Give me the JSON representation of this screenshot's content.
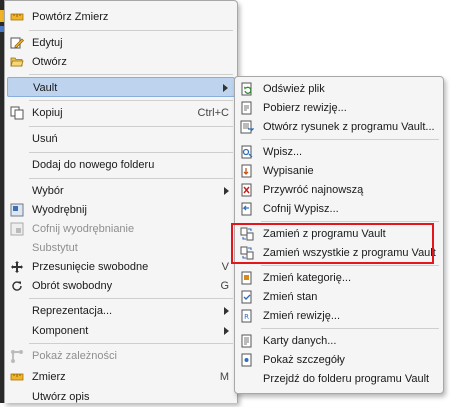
{
  "main_menu": {
    "items": [
      {
        "label": "Powtórz Zmierz",
        "icon": "ruler-icon"
      },
      {
        "label": "Edytuj",
        "icon": "edit-icon"
      },
      {
        "label": "Otwórz",
        "icon": "folder-open-icon"
      },
      {
        "label": "Vault",
        "icon": "",
        "submenu": true
      },
      {
        "label": "Kopiuj",
        "icon": "copy-icon",
        "shortcut": "Ctrl+C"
      },
      {
        "label": "Usuń",
        "icon": ""
      },
      {
        "label": "Dodaj do nowego folderu",
        "icon": ""
      },
      {
        "label": "Wybór",
        "icon": "",
        "submenu": true
      },
      {
        "label": "Wyodrębnij",
        "icon": "extract-icon"
      },
      {
        "label": "Cofnij wyodrębnianie",
        "icon": "undo-extract-icon",
        "disabled": true
      },
      {
        "label": "Substytut",
        "icon": "",
        "disabled": true
      },
      {
        "label": "Przesunięcie swobodne",
        "icon": "move-icon",
        "shortcut": "V"
      },
      {
        "label": "Obrót swobodny",
        "icon": "rotate-icon",
        "shortcut": "G"
      },
      {
        "label": "Reprezentacja...",
        "icon": "",
        "submenu": true
      },
      {
        "label": "Komponent",
        "icon": "",
        "submenu": true
      },
      {
        "label": "Pokaż zależności",
        "icon": "dependencies-icon",
        "disabled": true
      },
      {
        "label": "Zmierz",
        "icon": "ruler-icon",
        "shortcut": "M"
      },
      {
        "label": "Utwórz opis",
        "icon": ""
      }
    ]
  },
  "vault_submenu": {
    "items": [
      {
        "label": "Odśwież plik",
        "icon": "refresh-file-icon"
      },
      {
        "label": "Pobierz rewizję...",
        "icon": "get-revision-icon"
      },
      {
        "label": "Otwórz rysunek z programu Vault...",
        "icon": "open-drawing-icon"
      },
      {
        "label": "Wpisz...",
        "icon": "check-in-icon"
      },
      {
        "label": "Wypisanie",
        "icon": "check-out-icon"
      },
      {
        "label": "Przywróć najnowszą",
        "icon": "undo-checkout-icon"
      },
      {
        "label": "Cofnij Wypisz...",
        "icon": "undo-checkout-icon"
      },
      {
        "label": "Zamień z programu Vault",
        "icon": "replace-icon"
      },
      {
        "label": "Zamień wszystkie z programu Vault",
        "icon": "replace-all-icon"
      },
      {
        "label": "Zmień kategorię...",
        "icon": "change-category-icon"
      },
      {
        "label": "Zmień stan",
        "icon": "change-state-icon"
      },
      {
        "label": "Zmień rewizję...",
        "icon": "change-revision-icon"
      },
      {
        "label": "Karty danych...",
        "icon": "datacards-icon"
      },
      {
        "label": "Pokaż szczegóły",
        "icon": "details-icon"
      },
      {
        "label": "Przejdź do folderu programu Vault",
        "icon": ""
      }
    ]
  },
  "colors": {
    "highlight": "#bed3ee",
    "highlight_border": "#8aaedb",
    "annotation_red": "#e5161b",
    "menu_bg": "#f5f5f5"
  }
}
